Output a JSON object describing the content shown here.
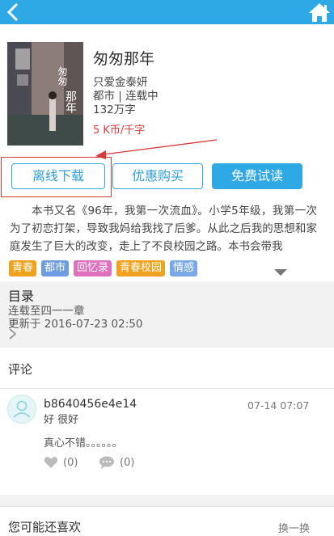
{
  "book": {
    "title": "匆匆那年",
    "author": "只爱金泰妍",
    "genre_status": "都市 | 连载中",
    "word_count": "132万字",
    "price": "5 K币/千字",
    "description": "本书又名《96年，我第一次流血》。小学5年级，我第一次为了初恋打架，导致我妈给我找了后爹。从此之后我的思想和家庭发生了巨大的改变，走上了不良校园之路。本书会带我"
  },
  "actions": {
    "offline_download": "离线下载",
    "discount_buy": "优惠购买",
    "free_read": "免费试读"
  },
  "tags": [
    {
      "label": "青春",
      "color": "#f0a21e"
    },
    {
      "label": "都市",
      "color": "#6f9be2"
    },
    {
      "label": "回忆录",
      "color": "#e070bd"
    },
    {
      "label": "青春校园",
      "color": "#f0a21e"
    },
    {
      "label": "情感",
      "color": "#79a8e8"
    }
  ],
  "toc": {
    "title": "目录",
    "status": "连载至四一一章",
    "updated": "更新于 2016-07-23 02:50"
  },
  "comments": {
    "header": "评论",
    "items": [
      {
        "user": "b8640456e4e14",
        "subtitle": "好 很好",
        "time": "07-14 07:07",
        "text": "真心不错。。。。。。",
        "likes": "(0)",
        "replies": "(0)"
      }
    ]
  },
  "recommend": {
    "title": "您可能还喜欢",
    "refresh": "换一换"
  },
  "colors": {
    "accent": "#2fa8e6",
    "price": "#e0393a",
    "highlight_box": "#d73838"
  }
}
